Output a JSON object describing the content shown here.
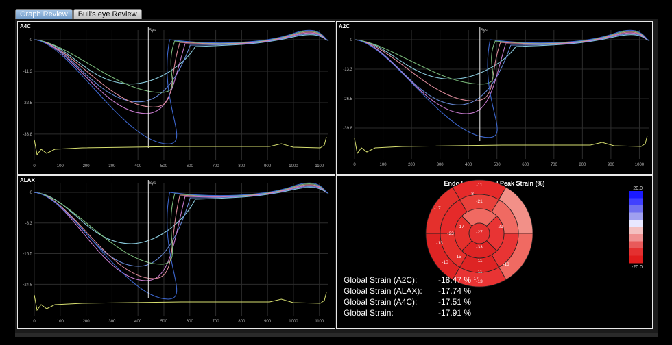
{
  "tabs": [
    {
      "label": "Graph Review",
      "active": true
    },
    {
      "label": "Bull's eye Review",
      "active": false
    }
  ],
  "series_colors": [
    "#8fd3e6",
    "#6a8fe0",
    "#cf7fd6",
    "#e58fa0",
    "#7fc27f",
    "#3f6ad6"
  ],
  "ecg_color": "#d8e070",
  "marker_label": "Sys",
  "panels": [
    {
      "label": "A4C",
      "yticks": [
        "0",
        "-11.3",
        "-22.5",
        "-33.8"
      ],
      "xticks": [
        "0",
        "100",
        "200",
        "300",
        "400",
        "500",
        "600",
        "700",
        "800",
        "900",
        "1000",
        "1100"
      ],
      "sys_ms": 440
    },
    {
      "label": "A2C",
      "yticks": [
        "0",
        "-13.3",
        "-26.5",
        "-39.8"
      ],
      "xticks": [
        "0",
        "100",
        "200",
        "300",
        "400",
        "500",
        "600",
        "700",
        "800",
        "900",
        "1000"
      ],
      "sys_ms": 440
    },
    {
      "label": "ALAX",
      "yticks": [
        "0",
        "-8.3",
        "-16.5",
        "-24.8"
      ],
      "xticks": [
        "0",
        "100",
        "200",
        "300",
        "400",
        "500",
        "600",
        "700",
        "800",
        "900",
        "1000",
        "1100"
      ],
      "sys_ms": 440
    }
  ],
  "bullseye": {
    "title": "Endo Longitudinal Peak Strain (%)",
    "segments": [
      "-11",
      "-8",
      "-17",
      "-13",
      "-10",
      "-17",
      "-21",
      "-17",
      "-29",
      "-11",
      "-23",
      "-15",
      "-27",
      "-33",
      "-13",
      "-11",
      "-13"
    ],
    "scale_max": "20.0",
    "scale_min": "-20.0"
  },
  "global_strain": [
    {
      "label": "Global Strain (A2C):",
      "value": "-18.47 %"
    },
    {
      "label": "Global Strain (ALAX):",
      "value": "-17.74 %"
    },
    {
      "label": "Global Strain (A4C):",
      "value": "-17.51 %"
    },
    {
      "label": "Global Strain:",
      "value": "-17.91 %"
    }
  ]
}
